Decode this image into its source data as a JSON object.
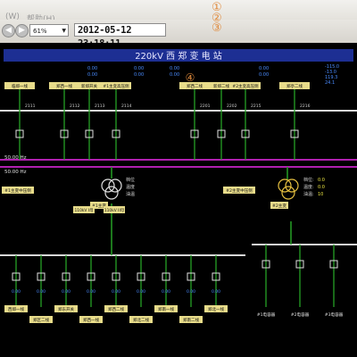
{
  "menubar": {
    "view_menu": "(W)",
    "help_menu": "帮助(H)"
  },
  "toolbar": {
    "back_icon": "back-arrow-icon",
    "forward_icon": "forward-arrow-icon",
    "zoom_value": "61%",
    "datetime": "2012-05-12 23:18:11"
  },
  "markers": {
    "m1": "①",
    "m2": "②",
    "m3": "③",
    "m4": "④"
  },
  "diagram": {
    "title": "220kV 西 郑 变 电 站",
    "bus_labels": {
      "bus_a": "50.00 Hz",
      "bus_b": "50.00 Hz"
    },
    "top_feeders": [
      "临郑一线",
      "郑西一线",
      "新郑开关",
      "#1主变高压侧",
      "郑西二线",
      "新郑二线",
      "#2主变高压侧",
      "郑亭二线"
    ],
    "top_feeder_values": [
      "0.00",
      "0.00",
      "0.00",
      "0.00",
      "0.00",
      "0.00",
      "0.00",
      "0.00",
      "-115.0",
      "-13.0",
      "119.3",
      "24.1"
    ],
    "top_switch_ids": [
      "2111",
      "2112",
      "2113",
      "2114",
      "2201",
      "2202",
      "2215",
      "2216"
    ],
    "transformer_readouts": {
      "t1": [
        "档位",
        "温度",
        "油温"
      ],
      "t2": [
        "档位:",
        "温度:",
        "油温:"
      ],
      "t2_values": [
        "0.0",
        "0.0",
        "10"
      ]
    },
    "mid_labels": [
      "#1主变中压侧",
      "#1主变",
      "#2主变中压侧",
      "#2主变",
      "110kV I母",
      "110kV II母"
    ],
    "bottom_feeders": [
      "西郑一线",
      "郑区二线",
      "郑东开关",
      "郑西一线",
      "郑西二线",
      "郑北二线",
      "郑南一线",
      "郑南二线",
      "郑北一线"
    ],
    "bottom_feeder_values": [
      "0.00",
      "0.00",
      "0.00",
      "0.00",
      "0.00",
      "0.00",
      "0.00",
      "0.00",
      "0.00"
    ],
    "lv_labels": [
      "#1电容器",
      "#2电容器",
      "#3电容器"
    ]
  }
}
